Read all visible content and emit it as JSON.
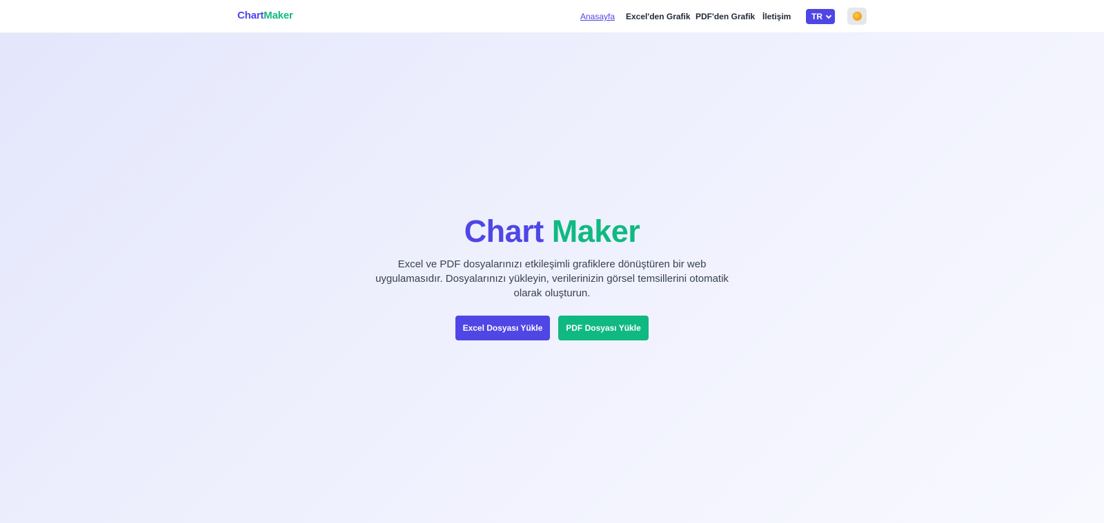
{
  "brand": {
    "part1": "Chart",
    "part2": "Maker"
  },
  "nav": {
    "items": [
      "Anasayfa",
      "Excel'den Grafik",
      "PDF'den Grafik",
      "İletişim"
    ]
  },
  "language": {
    "selected": "TR"
  },
  "theme_toggle": {
    "icon": "sun-icon"
  },
  "hero": {
    "title_part1": "Chart",
    "title_part2": "Maker",
    "description": "Excel ve PDF dosyalarınızı etkileşimli grafiklere dönüştüren bir web uygulamasıdır. Dosyalarınızı yükleyin, verilerinizin görsel temsillerini otomatik olarak oluşturun.",
    "excel_button": "Excel Dosyası Yükle",
    "pdf_button": "PDF Dosyası Yükle"
  },
  "colors": {
    "primary": "#4f46e5",
    "accent": "#10b981"
  }
}
